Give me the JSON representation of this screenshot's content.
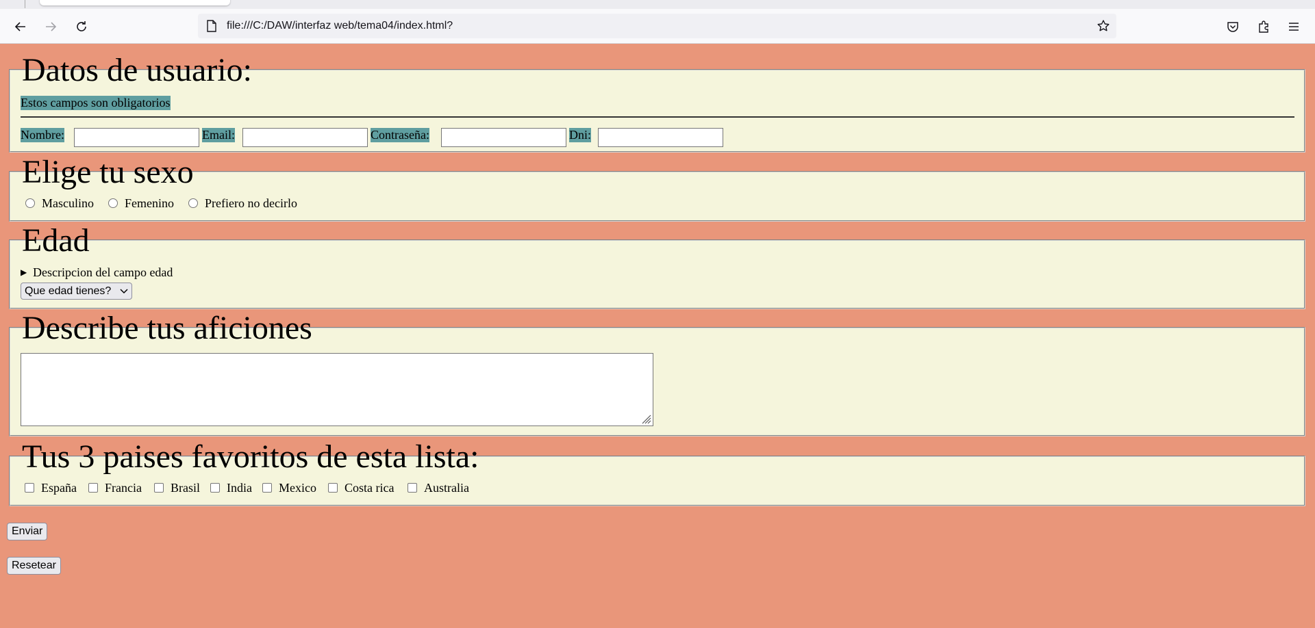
{
  "browser": {
    "url": "file:///C:/DAW/interfaz web/tema04/index.html?"
  },
  "datos": {
    "legend": "Datos de usuario:",
    "note": "Estos campos son obligatorios",
    "labels": {
      "nombre": "Nombre:",
      "email": "Email:",
      "password": "Contraseña:",
      "dni": "Dni:"
    },
    "values": {
      "nombre": "",
      "email": "",
      "password": "",
      "dni": ""
    }
  },
  "sexo": {
    "legend": "Elige tu sexo",
    "options": [
      "Masculino",
      "Femenino",
      "Prefiero no decirlo"
    ]
  },
  "edad": {
    "legend": "Edad",
    "summary": "Descripcion del campo edad",
    "select_value": "Que edad tienes?"
  },
  "aficiones": {
    "legend": "Describe tus aficiones",
    "value": ""
  },
  "paises": {
    "legend": "Tus 3 paises favoritos de esta lista:",
    "options": [
      "España",
      "Francia",
      "Brasil",
      "India",
      "Mexico",
      "Costa rica",
      "Australia"
    ]
  },
  "buttons": {
    "submit": "Enviar",
    "reset": "Resetear"
  },
  "colors": {
    "page_bg": "#e9967a",
    "fieldset_bg": "#f5f5dc",
    "label_highlight": "#5f9ea0"
  },
  "icons": [
    "back-arrow-icon",
    "forward-arrow-icon",
    "reload-icon",
    "page-icon",
    "bookmark-star-icon",
    "pocket-icon",
    "extensions-icon",
    "menu-icon"
  ]
}
